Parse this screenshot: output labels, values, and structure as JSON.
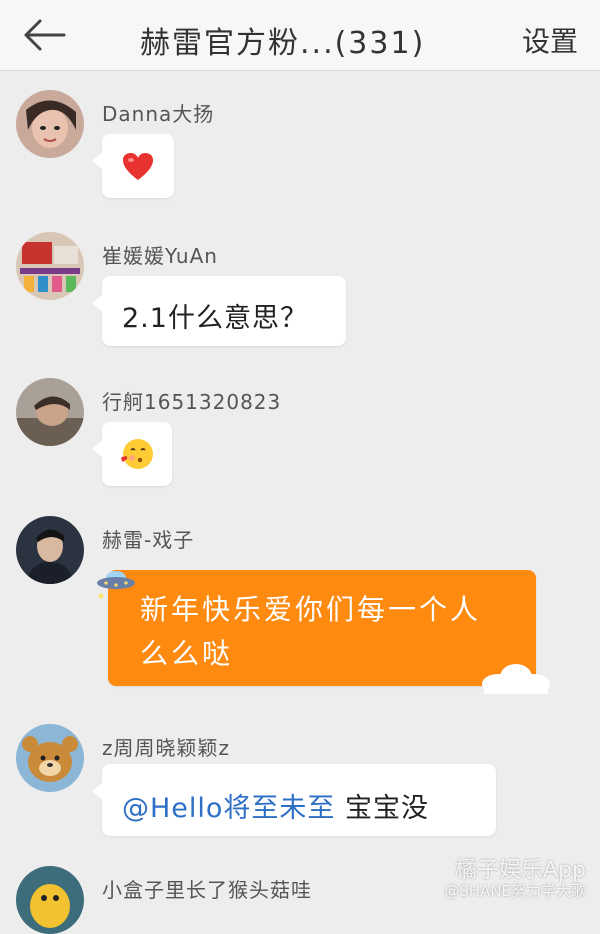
{
  "header": {
    "title": "赫雷官方粉...(331)",
    "settings_label": "设置",
    "back_icon": "arrow-left-icon"
  },
  "messages": [
    {
      "sender": "Danna大扬",
      "content": "",
      "content_icon": "red-heart-emoji"
    },
    {
      "sender": "崔媛媛YuAn",
      "content": "2.1什么意思？"
    },
    {
      "sender": "行舸1651320823",
      "content": "",
      "content_icon": "blowing-kiss-emoji"
    },
    {
      "sender": "赫雷-戏子",
      "content_line1": "新年快乐爱你们每一个人",
      "content_line2": "么么哒",
      "bubble_color": "#ff8a10"
    },
    {
      "sender": "z周周晓颖颖z",
      "mention": "@Hello将至未至",
      "content": " 宝宝没"
    },
    {
      "sender": "小盒子里长了猴头菇哇"
    }
  ],
  "watermark": {
    "line1": "橘子娱乐App",
    "line2": "@SHANE努力学大歌"
  }
}
